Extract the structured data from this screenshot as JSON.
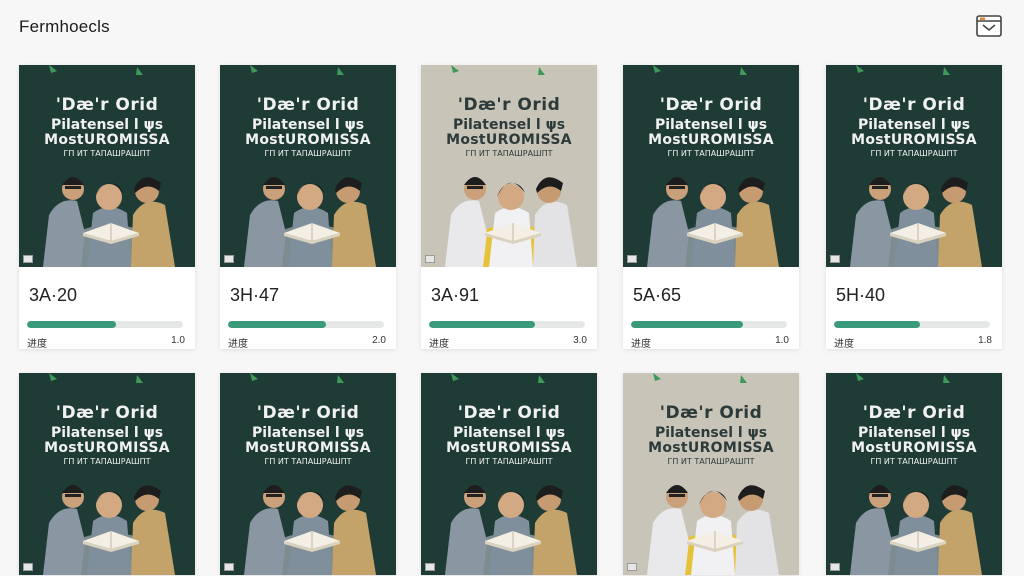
{
  "app": {
    "title": "Fermhoecls"
  },
  "header": {
    "corner_icon": "panel-toggle-icon"
  },
  "colors": {
    "dark_cover_bg": "#1f3b36",
    "light_cover_bg": "#c9c4b8",
    "progress_fill": "#3a9a7b",
    "progress_track": "#e6e8e8"
  },
  "cover": {
    "line1": "'Dæ'r Orid",
    "line2": "Pilatensel l ψs",
    "line3": "MostUROMISSA",
    "line4": "ГП ИТ ТАПАШРАШПТ"
  },
  "cards": [
    {
      "time": "3A·20",
      "progress_label": "进度",
      "rate": "1.0",
      "progress": 0.57,
      "theme": "dark"
    },
    {
      "time": "3H·47",
      "progress_label": "进度",
      "rate": "2.0",
      "progress": 0.63,
      "theme": "dark"
    },
    {
      "time": "3A·91",
      "progress_label": "进度",
      "rate": "3.0",
      "progress": 0.68,
      "theme": "light"
    },
    {
      "time": "5A·65",
      "progress_label": "进度",
      "rate": "1.0",
      "progress": 0.72,
      "theme": "dark"
    },
    {
      "time": "5H·40",
      "progress_label": "进度",
      "rate": "1.8",
      "progress": 0.55,
      "theme": "dark"
    },
    {
      "theme": "dark"
    },
    {
      "theme": "dark"
    },
    {
      "theme": "dark"
    },
    {
      "theme": "light"
    },
    {
      "theme": "dark"
    }
  ]
}
